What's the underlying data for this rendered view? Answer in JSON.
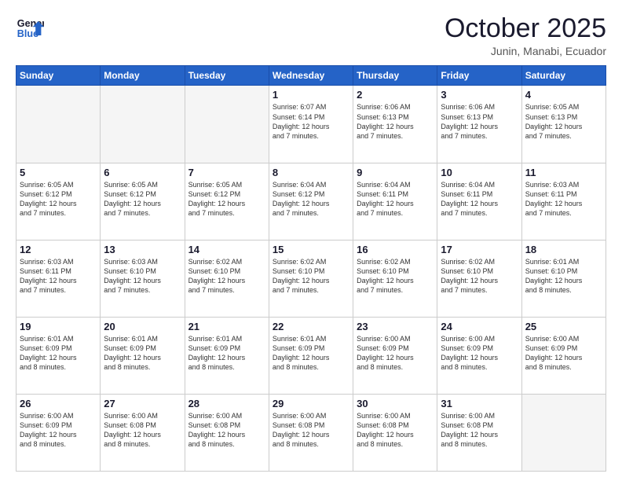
{
  "header": {
    "logo_line1": "General",
    "logo_line2": "Blue",
    "month": "October 2025",
    "location": "Junin, Manabi, Ecuador"
  },
  "days_of_week": [
    "Sunday",
    "Monday",
    "Tuesday",
    "Wednesday",
    "Thursday",
    "Friday",
    "Saturday"
  ],
  "weeks": [
    [
      {
        "day": "",
        "info": ""
      },
      {
        "day": "",
        "info": ""
      },
      {
        "day": "",
        "info": ""
      },
      {
        "day": "1",
        "info": "Sunrise: 6:07 AM\nSunset: 6:14 PM\nDaylight: 12 hours\nand 7 minutes."
      },
      {
        "day": "2",
        "info": "Sunrise: 6:06 AM\nSunset: 6:13 PM\nDaylight: 12 hours\nand 7 minutes."
      },
      {
        "day": "3",
        "info": "Sunrise: 6:06 AM\nSunset: 6:13 PM\nDaylight: 12 hours\nand 7 minutes."
      },
      {
        "day": "4",
        "info": "Sunrise: 6:05 AM\nSunset: 6:13 PM\nDaylight: 12 hours\nand 7 minutes."
      }
    ],
    [
      {
        "day": "5",
        "info": "Sunrise: 6:05 AM\nSunset: 6:12 PM\nDaylight: 12 hours\nand 7 minutes."
      },
      {
        "day": "6",
        "info": "Sunrise: 6:05 AM\nSunset: 6:12 PM\nDaylight: 12 hours\nand 7 minutes."
      },
      {
        "day": "7",
        "info": "Sunrise: 6:05 AM\nSunset: 6:12 PM\nDaylight: 12 hours\nand 7 minutes."
      },
      {
        "day": "8",
        "info": "Sunrise: 6:04 AM\nSunset: 6:12 PM\nDaylight: 12 hours\nand 7 minutes."
      },
      {
        "day": "9",
        "info": "Sunrise: 6:04 AM\nSunset: 6:11 PM\nDaylight: 12 hours\nand 7 minutes."
      },
      {
        "day": "10",
        "info": "Sunrise: 6:04 AM\nSunset: 6:11 PM\nDaylight: 12 hours\nand 7 minutes."
      },
      {
        "day": "11",
        "info": "Sunrise: 6:03 AM\nSunset: 6:11 PM\nDaylight: 12 hours\nand 7 minutes."
      }
    ],
    [
      {
        "day": "12",
        "info": "Sunrise: 6:03 AM\nSunset: 6:11 PM\nDaylight: 12 hours\nand 7 minutes."
      },
      {
        "day": "13",
        "info": "Sunrise: 6:03 AM\nSunset: 6:10 PM\nDaylight: 12 hours\nand 7 minutes."
      },
      {
        "day": "14",
        "info": "Sunrise: 6:02 AM\nSunset: 6:10 PM\nDaylight: 12 hours\nand 7 minutes."
      },
      {
        "day": "15",
        "info": "Sunrise: 6:02 AM\nSunset: 6:10 PM\nDaylight: 12 hours\nand 7 minutes."
      },
      {
        "day": "16",
        "info": "Sunrise: 6:02 AM\nSunset: 6:10 PM\nDaylight: 12 hours\nand 7 minutes."
      },
      {
        "day": "17",
        "info": "Sunrise: 6:02 AM\nSunset: 6:10 PM\nDaylight: 12 hours\nand 7 minutes."
      },
      {
        "day": "18",
        "info": "Sunrise: 6:01 AM\nSunset: 6:10 PM\nDaylight: 12 hours\nand 8 minutes."
      }
    ],
    [
      {
        "day": "19",
        "info": "Sunrise: 6:01 AM\nSunset: 6:09 PM\nDaylight: 12 hours\nand 8 minutes."
      },
      {
        "day": "20",
        "info": "Sunrise: 6:01 AM\nSunset: 6:09 PM\nDaylight: 12 hours\nand 8 minutes."
      },
      {
        "day": "21",
        "info": "Sunrise: 6:01 AM\nSunset: 6:09 PM\nDaylight: 12 hours\nand 8 minutes."
      },
      {
        "day": "22",
        "info": "Sunrise: 6:01 AM\nSunset: 6:09 PM\nDaylight: 12 hours\nand 8 minutes."
      },
      {
        "day": "23",
        "info": "Sunrise: 6:00 AM\nSunset: 6:09 PM\nDaylight: 12 hours\nand 8 minutes."
      },
      {
        "day": "24",
        "info": "Sunrise: 6:00 AM\nSunset: 6:09 PM\nDaylight: 12 hours\nand 8 minutes."
      },
      {
        "day": "25",
        "info": "Sunrise: 6:00 AM\nSunset: 6:09 PM\nDaylight: 12 hours\nand 8 minutes."
      }
    ],
    [
      {
        "day": "26",
        "info": "Sunrise: 6:00 AM\nSunset: 6:09 PM\nDaylight: 12 hours\nand 8 minutes."
      },
      {
        "day": "27",
        "info": "Sunrise: 6:00 AM\nSunset: 6:08 PM\nDaylight: 12 hours\nand 8 minutes."
      },
      {
        "day": "28",
        "info": "Sunrise: 6:00 AM\nSunset: 6:08 PM\nDaylight: 12 hours\nand 8 minutes."
      },
      {
        "day": "29",
        "info": "Sunrise: 6:00 AM\nSunset: 6:08 PM\nDaylight: 12 hours\nand 8 minutes."
      },
      {
        "day": "30",
        "info": "Sunrise: 6:00 AM\nSunset: 6:08 PM\nDaylight: 12 hours\nand 8 minutes."
      },
      {
        "day": "31",
        "info": "Sunrise: 6:00 AM\nSunset: 6:08 PM\nDaylight: 12 hours\nand 8 minutes."
      },
      {
        "day": "",
        "info": ""
      }
    ]
  ]
}
